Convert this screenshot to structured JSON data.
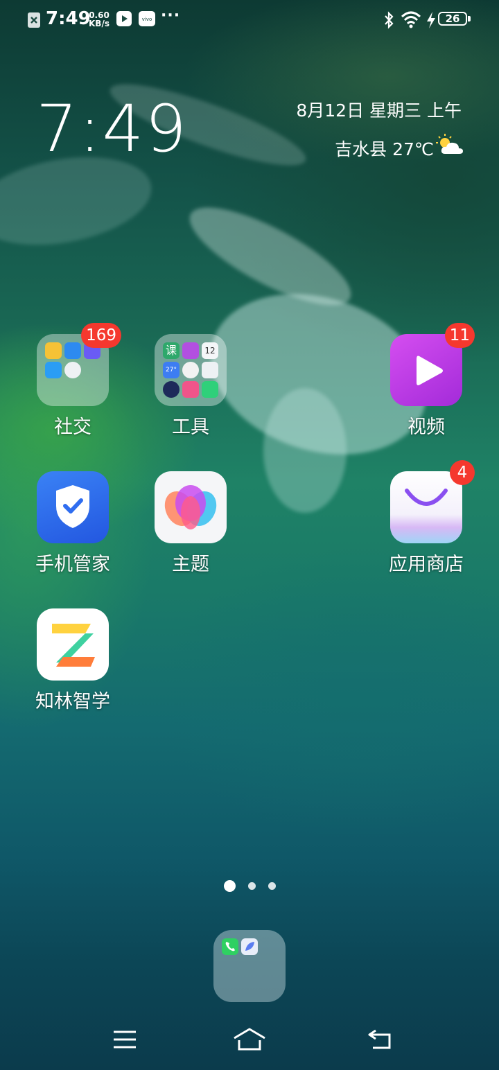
{
  "status_bar": {
    "time": "7:49",
    "net_speed_value": "0.60",
    "net_speed_unit": "KB/s",
    "more": "···",
    "battery": "26",
    "icons_left": [
      "close-notification-icon",
      "video-player-icon",
      "vivo-icon"
    ],
    "icons_right": [
      "bluetooth-icon",
      "wifi-icon",
      "charging-icon",
      "battery-icon"
    ]
  },
  "widget": {
    "clock": "7:49",
    "date": "8月12日 星期三 上午",
    "location_temp": "吉水县 27℃",
    "weather_icon": "partly-sunny-icon"
  },
  "apps": [
    {
      "label": "社交",
      "badge": "169"
    },
    {
      "label": "工具",
      "badge": ""
    },
    {
      "label": "视频",
      "badge": "11"
    },
    {
      "label": "手机管家",
      "badge": ""
    },
    {
      "label": "主题",
      "badge": ""
    },
    {
      "label": "应用商店",
      "badge": "4"
    },
    {
      "label": "知林智学",
      "badge": ""
    }
  ],
  "tools_folder": {
    "calendar_day": "12",
    "ke": "课",
    "weather_temp": "27°"
  },
  "page_indicator": {
    "count": 3,
    "active_index": 0
  },
  "dock": {
    "items": [
      "phone-icon",
      "messages-icon"
    ]
  },
  "nav_bar": {
    "items": [
      "menu-icon",
      "home-icon",
      "back-icon"
    ]
  },
  "colors": {
    "badge": "#f5382e",
    "video_app": "#c23de6",
    "security_app": "#2f6df0"
  }
}
